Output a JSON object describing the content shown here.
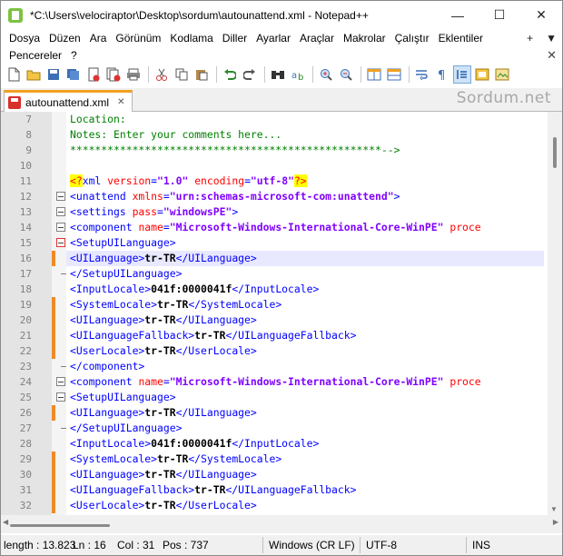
{
  "window": {
    "title": "*C:\\Users\\velociraptor\\Desktop\\sordum\\autounattend.xml - Notepad++",
    "minimize": "—",
    "maximize": "☐",
    "close": "✕"
  },
  "menu": {
    "row1": [
      "Dosya",
      "Düzen",
      "Ara",
      "Görünüm",
      "Kodlama",
      "Diller",
      "Ayarlar",
      "Araçlar",
      "Makrolar",
      "Çalıştır",
      "Eklentiler"
    ],
    "row2": [
      "Pencereler",
      "?"
    ],
    "right_plus": "+",
    "right_down": "▼",
    "right_close": "✕"
  },
  "tab": {
    "label": "autounattend.xml",
    "close": "✕"
  },
  "watermark": "Sordum.net",
  "status": {
    "length": "length : 13.823",
    "ln": "Ln : 16",
    "col": "Col : 31",
    "pos": "Pos : 737",
    "eol": "Windows (CR LF)",
    "encoding": "UTF-8",
    "mode": "INS"
  },
  "colors": {
    "accent_tab": "#f0a020",
    "change_marker": "#f08a24",
    "tag": "#0000ff",
    "attr": "#ff0000",
    "value": "#8000ff",
    "comment": "#008000"
  },
  "lines": [
    {
      "n": "7",
      "parts": [
        [
          "c-comment",
          "Location:"
        ]
      ]
    },
    {
      "n": "8",
      "parts": [
        [
          "c-comment",
          "Notes: Enter your comments here..."
        ]
      ]
    },
    {
      "n": "9",
      "parts": [
        [
          "c-comment",
          "**************************************************-->"
        ]
      ]
    },
    {
      "n": "10",
      "parts": []
    },
    {
      "n": "11",
      "parts": [
        [
          "c-decl",
          "<?"
        ],
        [
          "c-tag",
          "xml "
        ],
        [
          "c-attr",
          "version"
        ],
        [
          "c-tag",
          "="
        ],
        [
          "c-val",
          "\"1.0\""
        ],
        [
          "c-tag",
          " "
        ],
        [
          "c-attr",
          "encoding"
        ],
        [
          "c-tag",
          "="
        ],
        [
          "c-val",
          "\"utf-8\""
        ],
        [
          "c-decl",
          "?>"
        ]
      ]
    },
    {
      "n": "12",
      "parts": [
        [
          "c-tag",
          "<unattend "
        ],
        [
          "c-attr",
          "xmlns"
        ],
        [
          "c-tag",
          "="
        ],
        [
          "c-val",
          "\"urn:schemas-microsoft-com:unattend\""
        ],
        [
          "c-tag",
          ">"
        ]
      ]
    },
    {
      "n": "13",
      "parts": [
        [
          "c-tag",
          "<settings "
        ],
        [
          "c-attr",
          "pass"
        ],
        [
          "c-tag",
          "="
        ],
        [
          "c-val",
          "\"windowsPE\""
        ],
        [
          "c-tag",
          ">"
        ]
      ]
    },
    {
      "n": "14",
      "parts": [
        [
          "c-tag",
          "<component "
        ],
        [
          "c-attr",
          "name"
        ],
        [
          "c-tag",
          "="
        ],
        [
          "c-val",
          "\"Microsoft-Windows-International-Core-WinPE\""
        ],
        [
          "c-tag",
          " "
        ],
        [
          "c-attr",
          "proce"
        ]
      ]
    },
    {
      "n": "15",
      "parts": [
        [
          "c-tag",
          "<SetupUILanguage>"
        ]
      ]
    },
    {
      "n": "16",
      "parts": [
        [
          "c-tag",
          "<UILanguage>"
        ],
        [
          "c-text",
          "tr-TR"
        ],
        [
          "c-tag",
          "</UILanguage>"
        ]
      ]
    },
    {
      "n": "17",
      "parts": [
        [
          "c-tag",
          "</SetupUILanguage>"
        ]
      ]
    },
    {
      "n": "18",
      "parts": [
        [
          "c-tag",
          "<InputLocale>"
        ],
        [
          "c-text",
          "041f:0000041f"
        ],
        [
          "c-tag",
          "</InputLocale>"
        ]
      ]
    },
    {
      "n": "19",
      "parts": [
        [
          "c-tag",
          "<SystemLocale>"
        ],
        [
          "c-text",
          "tr-TR"
        ],
        [
          "c-tag",
          "</SystemLocale>"
        ]
      ]
    },
    {
      "n": "20",
      "parts": [
        [
          "c-tag",
          "<UILanguage>"
        ],
        [
          "c-text",
          "tr-TR"
        ],
        [
          "c-tag",
          "</UILanguage>"
        ]
      ]
    },
    {
      "n": "21",
      "parts": [
        [
          "c-tag",
          "<UILanguageFallback>"
        ],
        [
          "c-text",
          "tr-TR"
        ],
        [
          "c-tag",
          "</UILanguageFallback>"
        ]
      ]
    },
    {
      "n": "22",
      "parts": [
        [
          "c-tag",
          "<UserLocale>"
        ],
        [
          "c-text",
          "tr-TR"
        ],
        [
          "c-tag",
          "</UserLocale>"
        ]
      ]
    },
    {
      "n": "23",
      "parts": [
        [
          "c-tag",
          "</component>"
        ]
      ]
    },
    {
      "n": "24",
      "parts": [
        [
          "c-tag",
          "<component "
        ],
        [
          "c-attr",
          "name"
        ],
        [
          "c-tag",
          "="
        ],
        [
          "c-val",
          "\"Microsoft-Windows-International-Core-WinPE\""
        ],
        [
          "c-tag",
          " "
        ],
        [
          "c-attr",
          "proce"
        ]
      ]
    },
    {
      "n": "25",
      "parts": [
        [
          "c-tag",
          "<SetupUILanguage>"
        ]
      ]
    },
    {
      "n": "26",
      "parts": [
        [
          "c-tag",
          "<UILanguage>"
        ],
        [
          "c-text",
          "tr-TR"
        ],
        [
          "c-tag",
          "</UILanguage>"
        ]
      ]
    },
    {
      "n": "27",
      "parts": [
        [
          "c-tag",
          "</SetupUILanguage>"
        ]
      ]
    },
    {
      "n": "28",
      "parts": [
        [
          "c-tag",
          "<InputLocale>"
        ],
        [
          "c-text",
          "041f:0000041f"
        ],
        [
          "c-tag",
          "</InputLocale>"
        ]
      ]
    },
    {
      "n": "29",
      "parts": [
        [
          "c-tag",
          "<SystemLocale>"
        ],
        [
          "c-text",
          "tr-TR"
        ],
        [
          "c-tag",
          "</SystemLocale>"
        ]
      ]
    },
    {
      "n": "30",
      "parts": [
        [
          "c-tag",
          "<UILanguage>"
        ],
        [
          "c-text",
          "tr-TR"
        ],
        [
          "c-tag",
          "</UILanguage>"
        ]
      ]
    },
    {
      "n": "31",
      "parts": [
        [
          "c-tag",
          "<UILanguageFallback>"
        ],
        [
          "c-text",
          "tr-TR"
        ],
        [
          "c-tag",
          "</UILanguageFallback>"
        ]
      ]
    },
    {
      "n": "32",
      "parts": [
        [
          "c-tag",
          "<UserLocale>"
        ],
        [
          "c-text",
          "tr-TR"
        ],
        [
          "c-tag",
          "</UserLocale>"
        ]
      ]
    }
  ]
}
